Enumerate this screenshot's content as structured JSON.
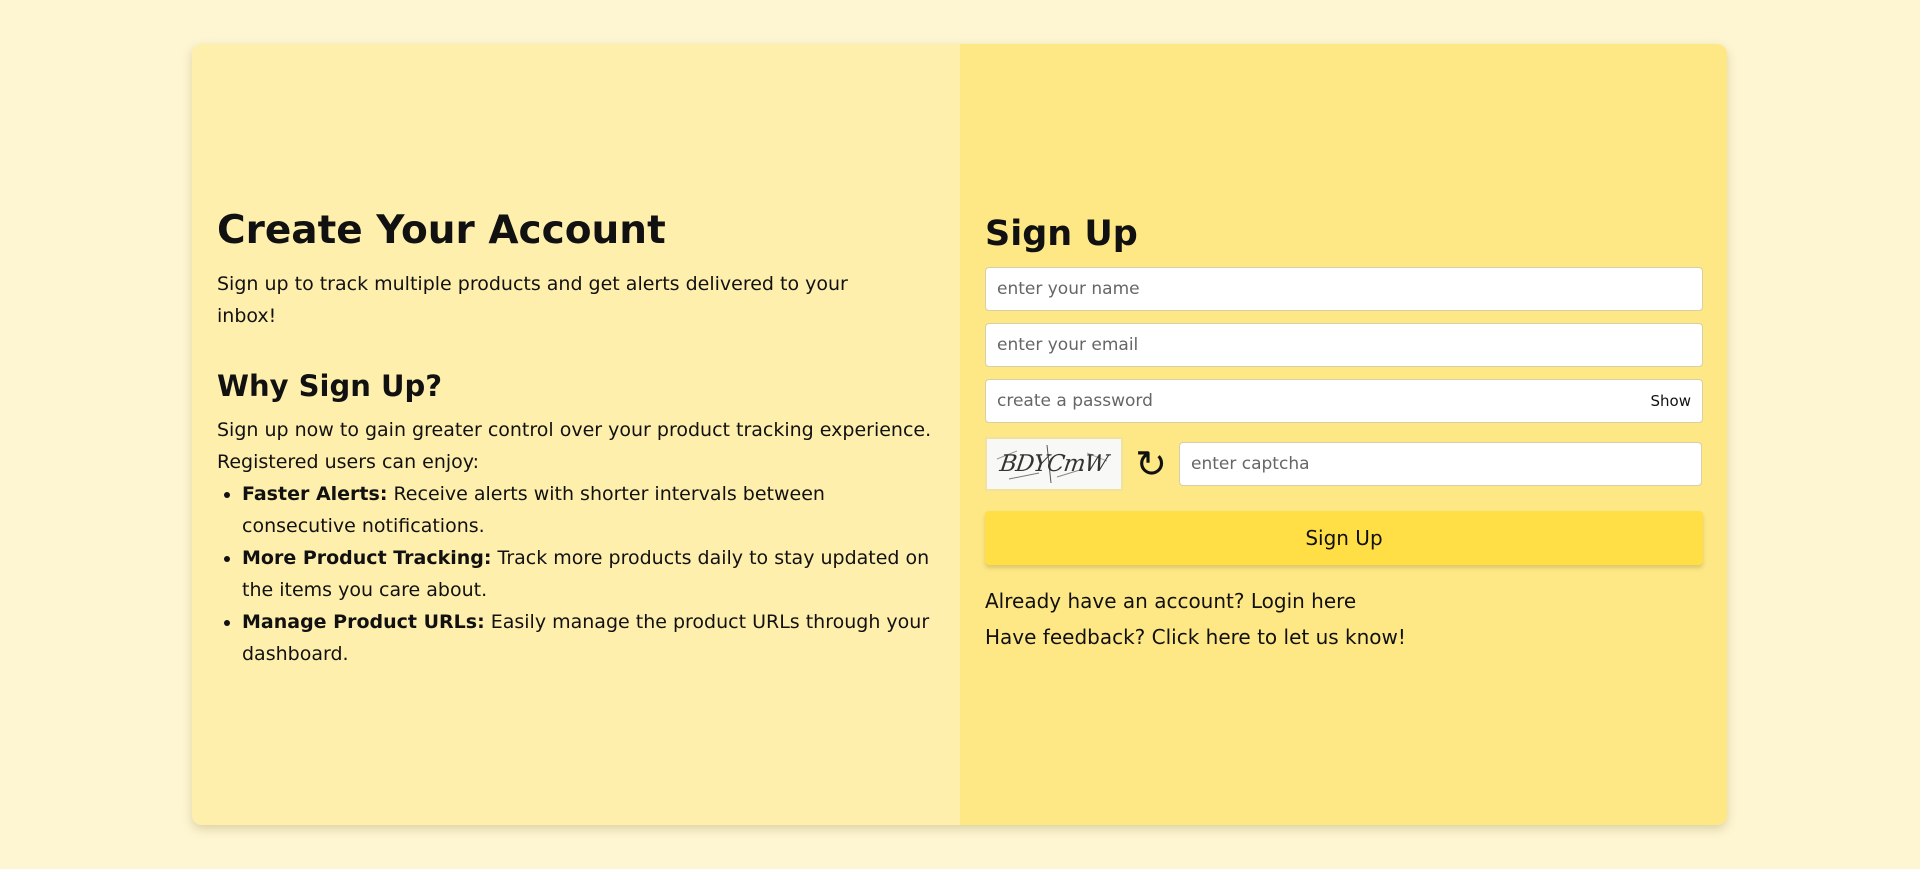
{
  "left": {
    "title": "Create Your Account",
    "intro": "Sign up to track multiple products and get alerts delivered to your inbox!",
    "why_title": "Why Sign Up?",
    "why_text": "Sign up now to gain greater control over your product tracking experience. Registered users can enjoy:",
    "benefits": [
      {
        "label": "Faster Alerts:",
        "text": " Receive alerts with shorter intervals between consecutive notifications."
      },
      {
        "label": "More Product Tracking:",
        "text": " Track more products daily to stay updated on the items you care about."
      },
      {
        "label": "Manage Product URLs:",
        "text": " Easily manage the product URLs through your dashboard."
      }
    ]
  },
  "form": {
    "title": "Sign Up",
    "name_placeholder": "enter your name",
    "email_placeholder": "enter your email",
    "password_placeholder": "create a password",
    "show_label": "Show",
    "captcha_text": "BDYCmW",
    "refresh_glyph": "↻",
    "captcha_placeholder": "enter captcha",
    "submit_label": "Sign Up",
    "login_link": "Already have an account? Login here",
    "feedback_link": "Have feedback? Click here to let us know!"
  },
  "colors": {
    "page_bg": "#fef6d2",
    "left_panel": "#feefad",
    "right_panel": "#fee886",
    "button": "#ffdf45"
  }
}
